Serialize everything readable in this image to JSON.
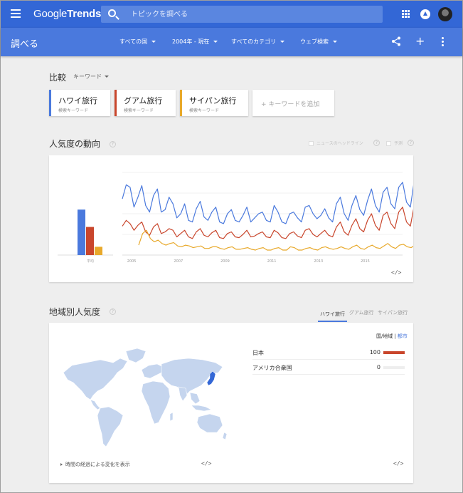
{
  "header": {
    "logo_google": "Google",
    "logo_trends": "Trends",
    "search_placeholder": "トピックを調べる"
  },
  "subbar": {
    "title": "調べる",
    "filters": [
      "すべての国",
      "2004年 - 現在",
      "すべてのカテゴリ",
      "ウェブ検索"
    ]
  },
  "compare": {
    "label": "比較",
    "type": "キーワード",
    "keywords": [
      {
        "name": "ハワイ旅行",
        "sub": "検索キーワード",
        "color": "#4a79dd"
      },
      {
        "name": "グアム旅行",
        "sub": "検索キーワード",
        "color": "#c9462c"
      },
      {
        "name": "サイパン旅行",
        "sub": "検索キーワード",
        "color": "#e8a92b"
      }
    ],
    "add_keyword": "+ キーワードを追加"
  },
  "trend": {
    "title": "人気度の動向",
    "help": "?",
    "opt_news": "ニュースのヘッドライン",
    "opt_forecast": "予測",
    "embed": "</>"
  },
  "chart_data": {
    "type": "line",
    "title": "",
    "x_ticks": [
      "2005",
      "2007",
      "2009",
      "2011",
      "2013",
      "2015"
    ],
    "x_range": [
      2004.6,
      2016.6
    ],
    "ylim": [
      0,
      100
    ],
    "grid": true,
    "average_label": "平均",
    "averages": [
      {
        "name": "ハワイ旅行",
        "value": 55,
        "color": "#4a79dd"
      },
      {
        "name": "グアム旅行",
        "value": 34,
        "color": "#c9462c"
      },
      {
        "name": "サイパン旅行",
        "value": 10,
        "color": "#e8a92b"
      }
    ],
    "series": [
      {
        "name": "ハワイ旅行",
        "color": "#4a79dd",
        "start": 2004.6,
        "step": 0.1667,
        "values": [
          68,
          85,
          82,
          58,
          70,
          84,
          60,
          52,
          72,
          80,
          52,
          55,
          70,
          62,
          45,
          50,
          62,
          42,
          40,
          56,
          65,
          46,
          42,
          52,
          58,
          40,
          38,
          50,
          55,
          42,
          40,
          48,
          58,
          40,
          45,
          50,
          52,
          42,
          40,
          60,
          52,
          40,
          38,
          50,
          52,
          45,
          40,
          58,
          60,
          50,
          44,
          48,
          56,
          45,
          40,
          62,
          70,
          50,
          42,
          60,
          72,
          55,
          48,
          66,
          80,
          60,
          52,
          76,
          82,
          62,
          56,
          82,
          88,
          64,
          58,
          90,
          76,
          60,
          58,
          96,
          84,
          64,
          60,
          98,
          80,
          60,
          62,
          88,
          82,
          58,
          55,
          82,
          72,
          54,
          58,
          68,
          78
        ]
      },
      {
        "name": "グアム旅行",
        "color": "#c9462c",
        "start": 2004.6,
        "step": 0.1667,
        "values": [
          35,
          42,
          38,
          30,
          36,
          40,
          28,
          24,
          34,
          38,
          26,
          28,
          32,
          30,
          22,
          26,
          30,
          22,
          20,
          28,
          32,
          24,
          22,
          27,
          30,
          21,
          20,
          26,
          28,
          22,
          21,
          25,
          30,
          22,
          23,
          26,
          28,
          22,
          21,
          30,
          27,
          21,
          20,
          26,
          28,
          23,
          21,
          30,
          32,
          25,
          22,
          26,
          30,
          24,
          22,
          34,
          40,
          28,
          24,
          36,
          44,
          32,
          28,
          42,
          50,
          36,
          30,
          48,
          52,
          38,
          32,
          52,
          58,
          40,
          35,
          60,
          50,
          38,
          36,
          62,
          56,
          40,
          38,
          62,
          52,
          38,
          38,
          56,
          54,
          36,
          34,
          52,
          46,
          34,
          36,
          44,
          50
        ]
      },
      {
        "name": "サイパン旅行",
        "color": "#e8a92b",
        "start": 2005.3,
        "step": 0.1667,
        "values": [
          12,
          26,
          30,
          20,
          16,
          18,
          14,
          12,
          14,
          15,
          11,
          10,
          12,
          11,
          9,
          10,
          11,
          8,
          8,
          10,
          10,
          8,
          7,
          9,
          10,
          7,
          7,
          8,
          9,
          7,
          6,
          8,
          9,
          6,
          6,
          8,
          9,
          6,
          6,
          10,
          9,
          6,
          6,
          8,
          9,
          7,
          6,
          9,
          10,
          8,
          7,
          8,
          10,
          8,
          7,
          10,
          12,
          8,
          7,
          10,
          12,
          9,
          8,
          11,
          14,
          10,
          8,
          12,
          13,
          10,
          9,
          12,
          13,
          9,
          8,
          12,
          11,
          8,
          8,
          12,
          12,
          8,
          8,
          11,
          10,
          8,
          8,
          10,
          9,
          7,
          7,
          9
        ]
      }
    ]
  },
  "region": {
    "title": "地域別人気度",
    "help": "?",
    "tabs": [
      "ハワイ旅行",
      "グアム旅行",
      "サイパン旅行"
    ],
    "legend_label": "国/地域",
    "legend_link": "都市",
    "rows": [
      {
        "name": "日本",
        "value": 100
      },
      {
        "name": "アメリカ合衆国",
        "value": 0
      }
    ],
    "time_link": "時間の経過による変化を表示",
    "embed": "</>"
  },
  "colors": {
    "header": "#3367d6",
    "subbar": "#4a79dd",
    "map_land": "#c5d5ee",
    "map_highlight": "#3367d6"
  }
}
